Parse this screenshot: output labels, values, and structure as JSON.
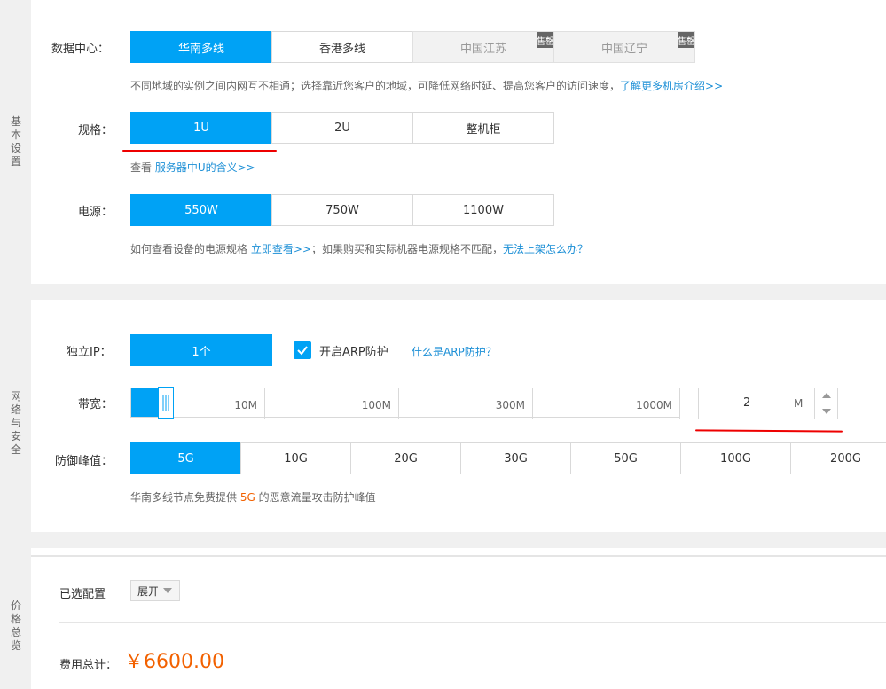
{
  "basic": {
    "side_label": "基本设置",
    "datacenter": {
      "label": "数据中心：",
      "options": [
        "华南多线",
        "香港多线",
        "中国江苏",
        "中国辽宁"
      ],
      "badge": "售罄",
      "hint_prefix": "不同地域的实例之间内网互不相通；选择靠近您客户的地域，可降低网络时延、提高您客户的访问速度，",
      "hint_link": "了解更多机房介绍>>"
    },
    "spec": {
      "label": "规格：",
      "options": [
        "1U",
        "2U",
        "整机柜"
      ],
      "hint_prefix": "查看",
      "hint_link": "服务器中U的含义>>"
    },
    "power": {
      "label": "电源：",
      "options": [
        "550W",
        "750W",
        "1100W"
      ],
      "hint_prefix": "如何查看设备的电源规格",
      "hint_link1": "立即查看>>",
      "hint_mid": "；如果购买和实际机器电源规格不匹配，",
      "hint_link2": "无法上架怎么办？"
    }
  },
  "network": {
    "side_label": "网络与安全",
    "ip": {
      "label": "独立IP：",
      "option": "1个",
      "arp_checked": true,
      "arp_label": "开启ARP防护",
      "arp_link": "什么是ARP防护？"
    },
    "bandwidth": {
      "label": "带宽：",
      "ticks": [
        "10M",
        "100M",
        "300M",
        "1000M"
      ],
      "value": "2",
      "unit": "M"
    },
    "defense": {
      "label": "防御峰值：",
      "options": [
        "5G",
        "10G",
        "20G",
        "30G",
        "50G",
        "100G",
        "200G"
      ],
      "hint_prefix": "华南多线节点免费提供",
      "hint_value": "5G",
      "hint_suffix": "的恶意流量攻击防护峰值"
    }
  },
  "price": {
    "side_label": "价格总览",
    "selected_label": "已选配置",
    "expand_label": "展开",
    "total_label": "费用总计：",
    "total_value": "￥6600.00"
  },
  "colors": {
    "accent": "#00a2f5",
    "link": "#1c8fd6",
    "price": "#f26100",
    "underline": "#e00000"
  }
}
